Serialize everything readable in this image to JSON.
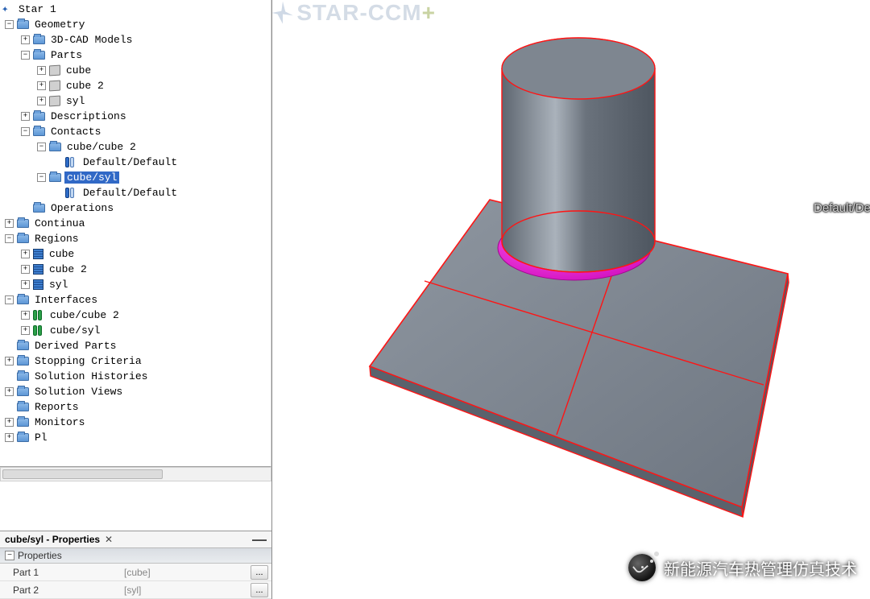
{
  "sim_name": "Star 1",
  "brand_text": "STAR-CCM",
  "brand_plus": "+",
  "scene_label": "Default/Default",
  "watermark_text": "新能源汽车热管理仿真技术",
  "tree": {
    "geometry": "Geometry",
    "cad_models": "3D-CAD Models",
    "parts": "Parts",
    "parts_children": [
      "cube",
      "cube 2",
      "syl"
    ],
    "descriptions": "Descriptions",
    "contacts": "Contacts",
    "contact_a": "cube/cube 2",
    "contact_a_child": "Default/Default",
    "contact_b": "cube/syl",
    "contact_b_child": "Default/Default",
    "operations": "Operations",
    "continua": "Continua",
    "regions": "Regions",
    "regions_children": [
      "cube",
      "cube 2",
      "syl"
    ],
    "interfaces": "Interfaces",
    "interfaces_children": [
      "cube/cube 2",
      "cube/syl"
    ],
    "derived_parts": "Derived Parts",
    "stopping_criteria": "Stopping Criteria",
    "solution_histories": "Solution Histories",
    "solution_views": "Solution Views",
    "reports": "Reports",
    "monitors": "Monitors",
    "plots_trunc": "Pl"
  },
  "properties": {
    "title": "cube/syl - Properties",
    "header": "Properties",
    "rows": [
      {
        "name": "Part 1",
        "value": "[cube]"
      },
      {
        "name": "Part 2",
        "value": "[syl]"
      }
    ],
    "ellipsis": "..."
  }
}
